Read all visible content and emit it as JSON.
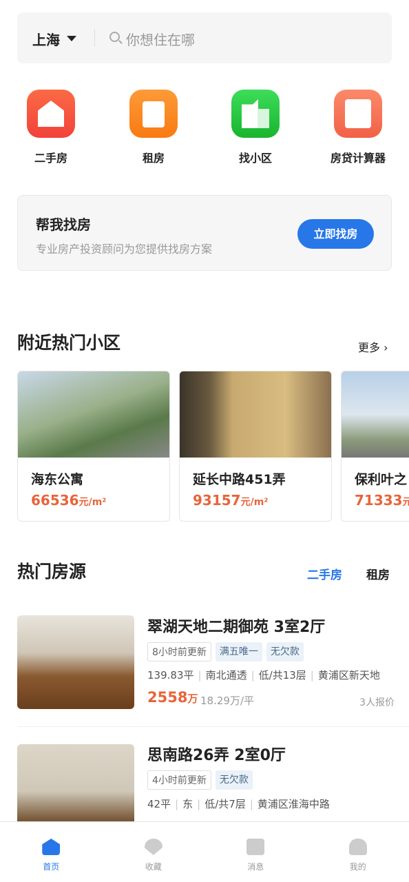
{
  "search": {
    "city": "上海",
    "placeholder": "你想住在哪"
  },
  "categories": [
    {
      "label": "二手房",
      "icon": "house-icon",
      "color": "#f4553d"
    },
    {
      "label": "租房",
      "icon": "suitcase-icon",
      "color": "#fb8a21"
    },
    {
      "label": "找小区",
      "icon": "building-icon",
      "color": "#21c33a"
    },
    {
      "label": "房贷计算器",
      "icon": "calculator-icon",
      "color": "#f47458"
    }
  ],
  "banner": {
    "title": "帮我找房",
    "subtitle": "专业房产投资顾问为您提供找房方案",
    "button": "立即找房"
  },
  "nearby": {
    "title": "附近热门小区",
    "more": "更多",
    "items": [
      {
        "name": "海东公寓",
        "price": "66536",
        "unit": "元/m²"
      },
      {
        "name": "延长中路451弄",
        "price": "93157",
        "unit": "元/m²"
      },
      {
        "name": "保利叶之",
        "price": "71333",
        "unit": "元"
      }
    ]
  },
  "hot": {
    "title": "热门房源",
    "tabs": [
      "二手房",
      "租房"
    ],
    "listings": [
      {
        "title": "翠湖天地二期御苑 3室2厅",
        "tags": [
          "8小时前更新",
          "满五唯一",
          "无欠款"
        ],
        "info": [
          "139.83平",
          "南北通透",
          "低/共13层",
          "黄浦区新天地"
        ],
        "price": "2558",
        "price_unit": "万",
        "unit_price": "18.29万/平",
        "quotes": "3人报价"
      },
      {
        "title": "思南路26弄 2室0厅",
        "tags": [
          "4小时前更新",
          "无欠款"
        ],
        "info": [
          "42平",
          "东",
          "低/共7层",
          "黄浦区淮海中路"
        ]
      }
    ]
  },
  "nav": [
    {
      "label": "首页",
      "icon": "home-icon",
      "active": true
    },
    {
      "label": "收藏",
      "icon": "heart-icon"
    },
    {
      "label": "消息",
      "icon": "message-icon"
    },
    {
      "label": "我的",
      "icon": "user-icon"
    }
  ],
  "colors": {
    "accent": "#2777e8",
    "price": "#e8643a"
  }
}
